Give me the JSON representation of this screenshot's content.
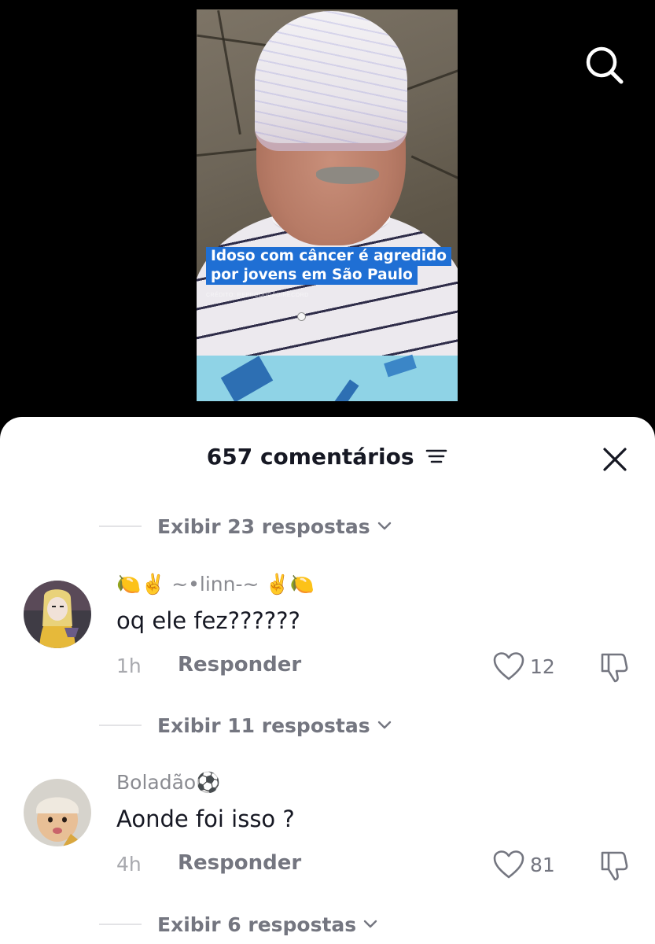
{
  "video": {
    "caption_line1": "Idoso com câncer é agredido",
    "caption_line2": "por jovens em São Paulo",
    "credit": "CRÉDITO: REPRODUÇÃO/RECORD",
    "caption_color": "#1f6fd4"
  },
  "header": {
    "search_icon": "search-icon"
  },
  "comments_panel": {
    "title": "657 comentários",
    "sort_icon": "sort-icon",
    "close_icon": "close-icon",
    "replies_rows": [
      {
        "label": "Exibir 23 respostas"
      },
      {
        "label": "Exibir 11 respostas"
      },
      {
        "label": "Exibir 6 respostas"
      }
    ],
    "comments": [
      {
        "username": "🍋✌️ ~•linn-~ ✌️🍋",
        "text": "oq ele fez??????",
        "time": "1h",
        "reply_label": "Responder",
        "likes": "12"
      },
      {
        "username": "Boladão⚽",
        "text": "Aonde foi isso ?",
        "time": "4h",
        "reply_label": "Responder",
        "likes": "81"
      }
    ]
  },
  "colors": {
    "text_primary": "#161823",
    "text_secondary": "#747680",
    "text_muted": "#a8a9ae"
  }
}
